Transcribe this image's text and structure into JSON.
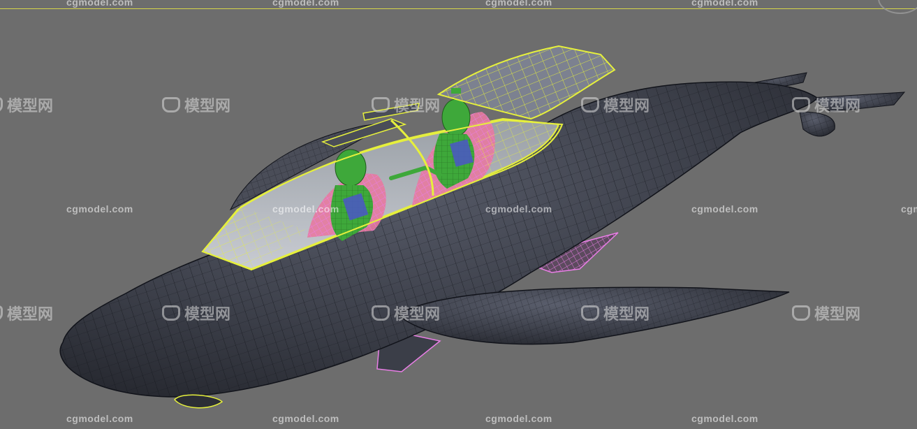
{
  "viewport": {
    "background": "#6d6d6d",
    "selection_color": "#e6f03c",
    "subselection_color": "#e97ee6"
  },
  "watermarks": {
    "url_text": "cgmodel.com",
    "cn_text": "模型网"
  },
  "model": {
    "hull_color": "#3b3e48",
    "wire_color": "#11131a",
    "canopy_color": "#e6f03c",
    "pilot_color": "#3ea83a",
    "seat_color": "#e77aa0",
    "harness_color": "#4b56c8"
  }
}
